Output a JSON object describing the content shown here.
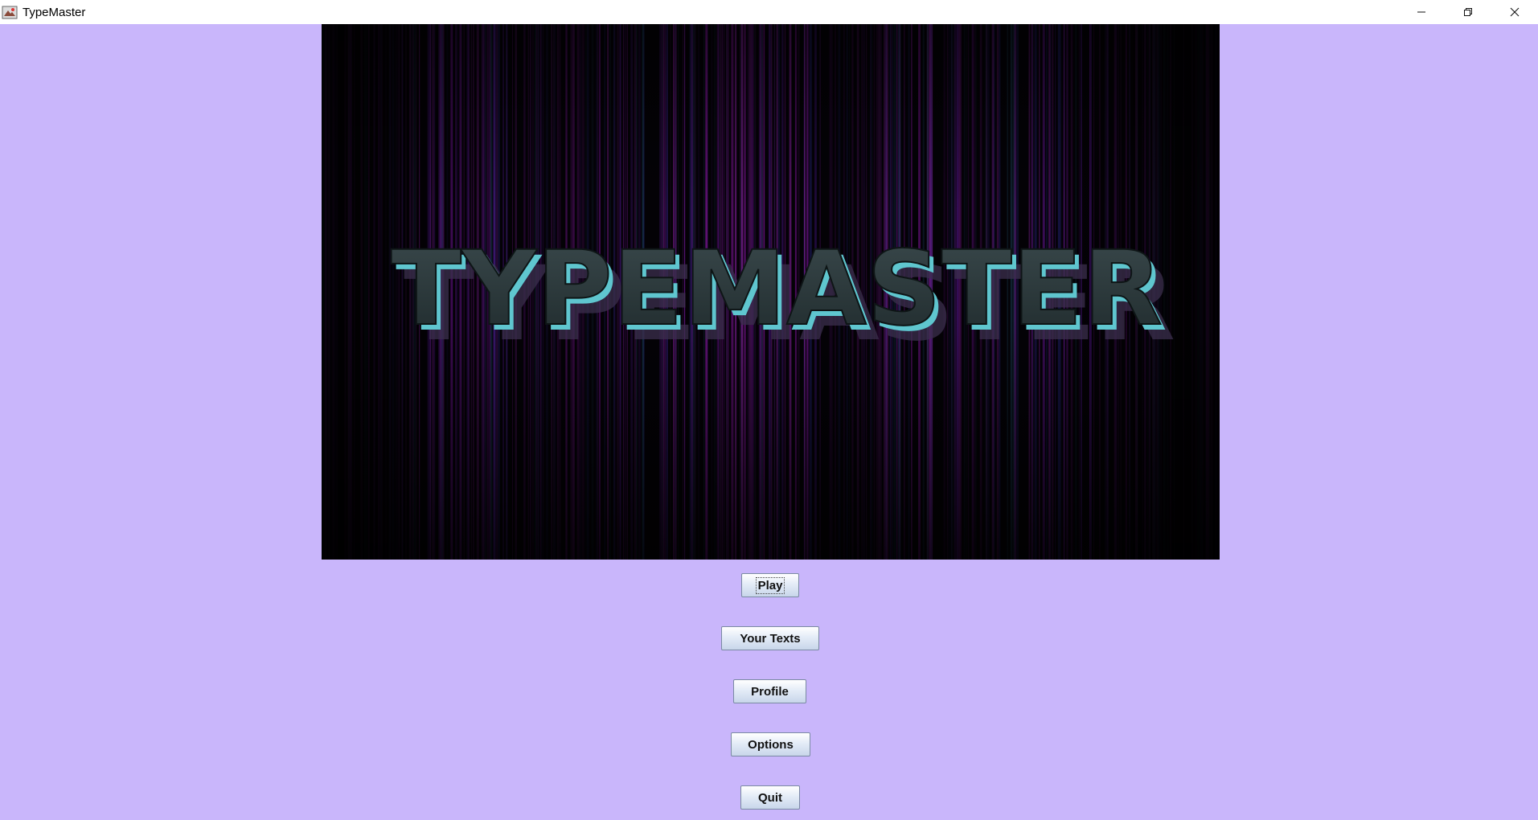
{
  "window": {
    "title": "TypeMaster",
    "background": "#c9b6fb"
  },
  "title_controls": {
    "minimize_icon": "minimize-icon",
    "restore_icon": "restore-icon",
    "close_icon": "close-icon"
  },
  "banner": {
    "logo_text": "TYPEMASTER",
    "colors": {
      "background": "#050208",
      "streak_purple": "#b21ed6",
      "letter_face": "#2c3a3d",
      "letter_edge": "#5fc6cf"
    }
  },
  "menu": {
    "play_label": "Play",
    "your_texts_label": "Your Texts",
    "profile_label": "Profile",
    "options_label": "Options",
    "quit_label": "Quit"
  }
}
